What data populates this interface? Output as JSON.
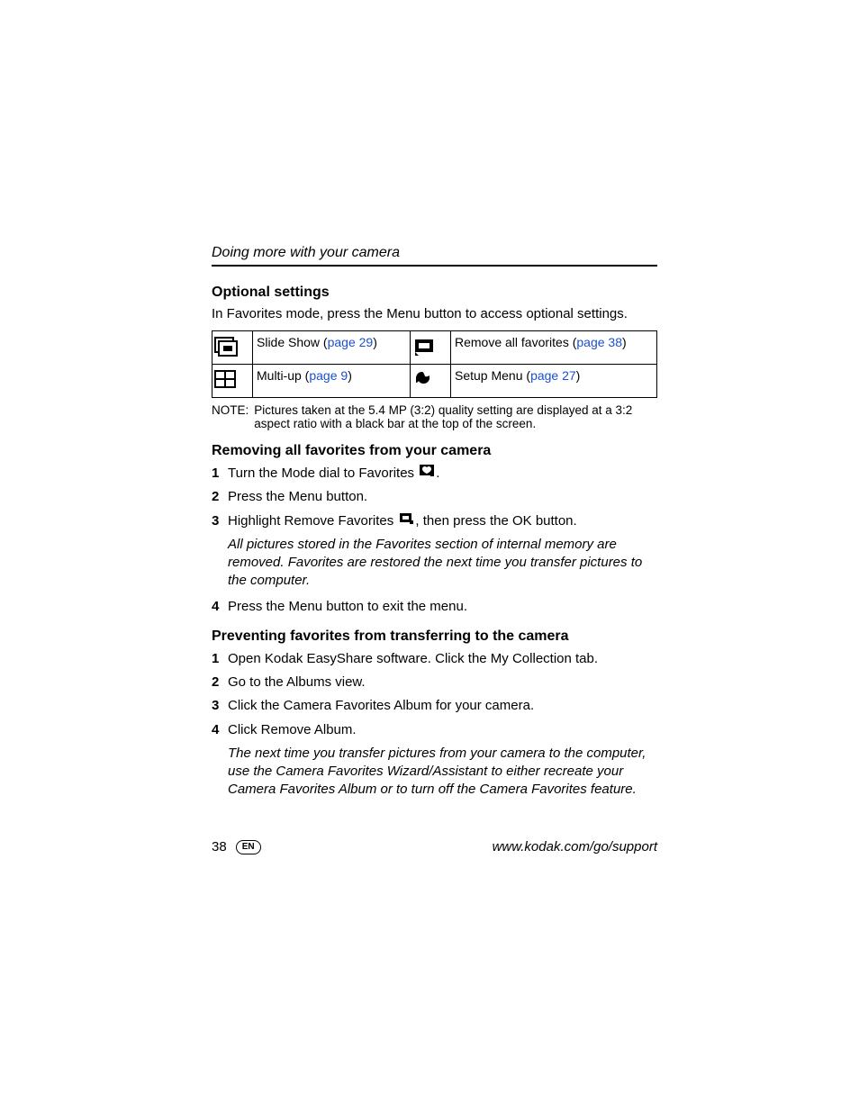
{
  "chapter": "Doing more with your camera",
  "section1": {
    "heading": "Optional settings",
    "intro": "In Favorites mode, press the Menu button to access optional settings."
  },
  "table": {
    "r1c1": {
      "label": "Slide Show (",
      "link": "page 29",
      "tail": ")"
    },
    "r1c2": {
      "label": "Remove all favorites (",
      "link": "page 38",
      "tail": ")"
    },
    "r2c1": {
      "label": "Multi-up (",
      "link": "page 9",
      "tail": ")"
    },
    "r2c2": {
      "label": "Setup Menu (",
      "link": "page 27",
      "tail": ")"
    }
  },
  "note": {
    "label": "NOTE:",
    "body": "Pictures taken at the 5.4 MP (3:2) quality setting are displayed at a 3:2 aspect ratio with a black bar at the top of the screen."
  },
  "section2": {
    "heading": "Removing all favorites from your camera",
    "steps": {
      "s1a": "Turn the Mode dial to Favorites ",
      "s1b": ".",
      "s2": "Press the Menu button.",
      "s3a": "Highlight Remove Favorites ",
      "s3b": ", then press the OK button.",
      "note": "All pictures stored in the Favorites section of internal memory are removed. Favorites are restored the next time you transfer pictures to the computer.",
      "s4": "Press the Menu button to exit the menu."
    }
  },
  "section3": {
    "heading": "Preventing favorites from transferring to the camera",
    "steps": {
      "s1": "Open Kodak EasyShare software. Click the My Collection tab.",
      "s2": "Go to the Albums view.",
      "s3": "Click the Camera Favorites Album for your camera.",
      "s4": "Click Remove Album.",
      "note": "The next time you transfer pictures from your camera to the computer, use the Camera Favorites Wizard/Assistant to either recreate your Camera Favorites Album or to turn off the Camera Favorites feature."
    }
  },
  "footer": {
    "page": "38",
    "lang": "EN",
    "url": "www.kodak.com/go/support"
  },
  "nums": {
    "n1": "1",
    "n2": "2",
    "n3": "3",
    "n4": "4"
  }
}
